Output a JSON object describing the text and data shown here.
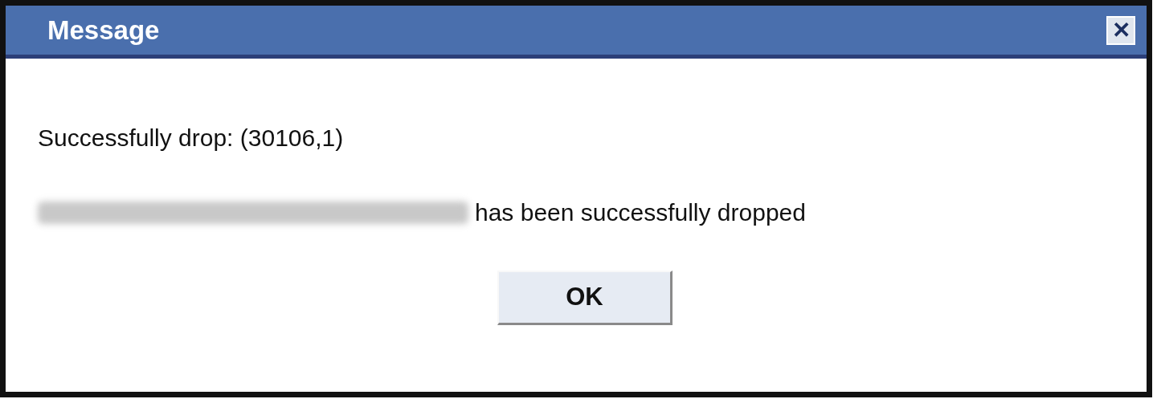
{
  "window": {
    "title": "Message",
    "close": "✕"
  },
  "message": {
    "lines": [
      {
        "kind": "plain",
        "text": "Successfully drop: (30106,1)"
      },
      {
        "kind": "redacted_prefix",
        "text": "has been successfully dropped"
      }
    ]
  },
  "buttons": [
    "OK"
  ]
}
